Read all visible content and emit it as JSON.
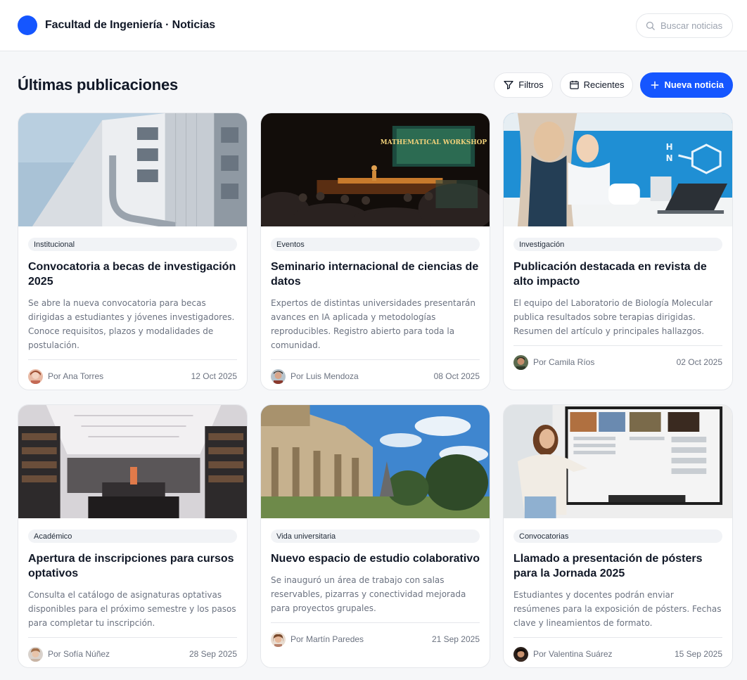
{
  "header": {
    "title": "Facultad de Ingeniería · Noticias",
    "search_placeholder": "Buscar noticias"
  },
  "toolbar": {
    "title": "Últimas publicaciones",
    "filters_label": "Filtros",
    "recent_label": "Recientes",
    "new_label": "Nueva noticia"
  },
  "colors": {
    "accent": "#1556ff"
  },
  "cards": [
    {
      "tag": "Institucional",
      "title": "Convocatoria a becas de investigación 2025",
      "desc": "Se abre la nueva convocatoria para becas dirigidas a estudiantes y jóvenes investigadores. Conoce requisitos, plazos y modalidades de postulación.",
      "author": "Por Ana Torres",
      "date": "12 Oct 2025"
    },
    {
      "tag": "Eventos",
      "title": "Seminario internacional de ciencias de datos",
      "desc": "Expertos de distintas universidades presentarán avances en IA aplicada y metodologías reproducibles. Registro abierto para toda la comunidad.",
      "author": "Por Luis Mendoza",
      "date": "08 Oct 2025",
      "image_text": "MATHEMATICAL WORKSHOP"
    },
    {
      "tag": "Investigación",
      "title": "Publicación destacada en revista de alto impacto",
      "desc": "El equipo del Laboratorio de Biología Molecular publica resultados sobre terapias dirigidas. Resumen del artículo y principales hallazgos.",
      "author": "Por Camila Ríos",
      "date": "02 Oct 2025"
    },
    {
      "tag": "Académico",
      "title": "Apertura de inscripciones para cursos optativos",
      "desc": "Consulta el catálogo de asignaturas optativas disponibles para el próximo semestre y los pasos para completar tu inscripción.",
      "author": "Por Sofía Núñez",
      "date": "28 Sep 2025"
    },
    {
      "tag": "Vida universitaria",
      "title": "Nuevo espacio de estudio colaborativo",
      "desc": "Se inauguró un área de trabajo con salas reservables, pizarras y conectividad mejorada para proyectos grupales.",
      "author": "Por Martín Paredes",
      "date": "21 Sep 2025"
    },
    {
      "tag": "Convocatorias",
      "title": "Llamado a presentación de pósters para la Jornada 2025",
      "desc": "Estudiantes y docentes podrán enviar resúmenes para la exposición de pósters. Fechas clave y lineamientos de formato.",
      "author": "Por Valentina Suárez",
      "date": "15 Sep 2025"
    }
  ]
}
